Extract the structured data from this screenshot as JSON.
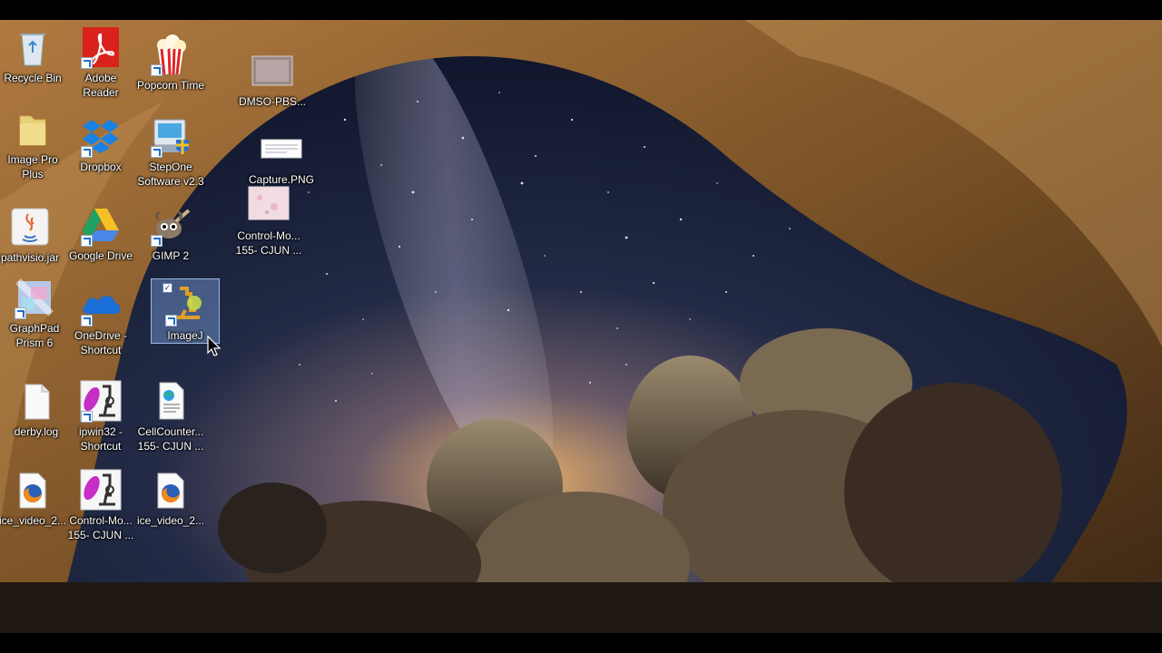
{
  "desktop": {
    "icons": [
      {
        "id": "recycle-bin",
        "label": "Recycle Bin",
        "icon": "recycle-bin-icon"
      },
      {
        "id": "adobe-reader",
        "label": "Adobe\nReader",
        "icon": "adobe-reader-icon"
      },
      {
        "id": "popcorn-time",
        "label": "Popcorn Time",
        "icon": "popcorn-time-icon"
      },
      {
        "id": "dmso-pbs",
        "label": "DMSO-PBS...",
        "icon": "image-thumbnail-icon"
      },
      {
        "id": "image-pro-plus",
        "label": "Image Pro\nPlus",
        "icon": "folder-icon"
      },
      {
        "id": "dropbox",
        "label": "Dropbox",
        "icon": "dropbox-icon"
      },
      {
        "id": "stepone",
        "label": "StepOne\nSoftware v2.3",
        "icon": "stepone-icon"
      },
      {
        "id": "capture-png",
        "label": "Capture.PNG",
        "icon": "image-thumbnail-icon"
      },
      {
        "id": "control-mo-1",
        "label": "Control-Mo...\n155- CJUN ...",
        "icon": "image-thumbnail-icon"
      },
      {
        "id": "pathvisio",
        "label": "pathvisio.jar",
        "icon": "java-icon"
      },
      {
        "id": "google-drive",
        "label": "Google Drive",
        "icon": "google-drive-icon"
      },
      {
        "id": "gimp",
        "label": "GIMP 2",
        "icon": "gimp-icon"
      },
      {
        "id": "graphpad",
        "label": "GraphPad\nPrism 6",
        "icon": "graphpad-icon"
      },
      {
        "id": "onedrive",
        "label": "OneDrive -\nShortcut",
        "icon": "onedrive-icon"
      },
      {
        "id": "imagej",
        "label": "ImageJ",
        "icon": "imagej-icon"
      },
      {
        "id": "derby-log",
        "label": "derby.log",
        "icon": "file-icon"
      },
      {
        "id": "ipwin32",
        "label": "ipwin32 -\nShortcut",
        "icon": "microscope-icon"
      },
      {
        "id": "cellcounter",
        "label": "CellCounter...\n155- CJUN ...",
        "icon": "web-file-icon"
      },
      {
        "id": "ice-video-1",
        "label": "ice_video_2...",
        "icon": "firefox-file-icon"
      },
      {
        "id": "control-mo-2",
        "label": "Control-Mo...\n155- CJUN ...",
        "icon": "microscope-icon"
      },
      {
        "id": "ice-video-2",
        "label": "ice_video_2...",
        "icon": "firefox-file-icon"
      }
    ]
  },
  "selected_icon": "ImageJ"
}
